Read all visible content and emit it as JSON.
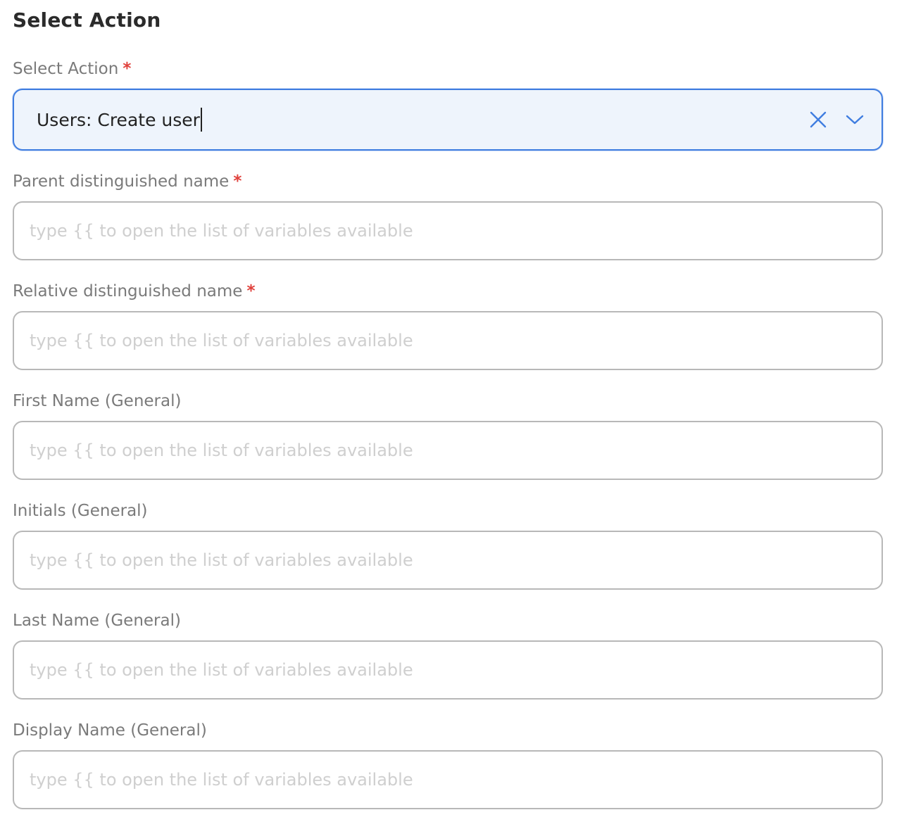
{
  "section": {
    "title": "Select Action"
  },
  "action_select": {
    "label": "Select Action",
    "required_mark": "*",
    "value": "Users: Create user"
  },
  "fields": [
    {
      "label": "Parent distinguished name",
      "required_mark": "*",
      "placeholder": "type {{ to open the list of variables available",
      "value": ""
    },
    {
      "label": "Relative distinguished name",
      "required_mark": "*",
      "placeholder": "type {{ to open the list of variables available",
      "value": ""
    },
    {
      "label": "First Name (General)",
      "placeholder": "type {{ to open the list of variables available",
      "value": ""
    },
    {
      "label": "Initials (General)",
      "placeholder": "type {{ to open the list of variables available",
      "value": ""
    },
    {
      "label": "Last Name (General)",
      "placeholder": "type {{ to open the list of variables available",
      "value": ""
    },
    {
      "label": "Display Name (General)",
      "placeholder": "type {{ to open the list of variables available",
      "value": ""
    }
  ],
  "icons": {
    "clear": "close-icon",
    "dropdown": "chevron-down-icon"
  },
  "colors": {
    "accent": "#3f7de0",
    "required": "#e0413c",
    "label": "#7a7a7a",
    "placeholder": "#cfcfcf",
    "border": "#b8b8b8"
  }
}
